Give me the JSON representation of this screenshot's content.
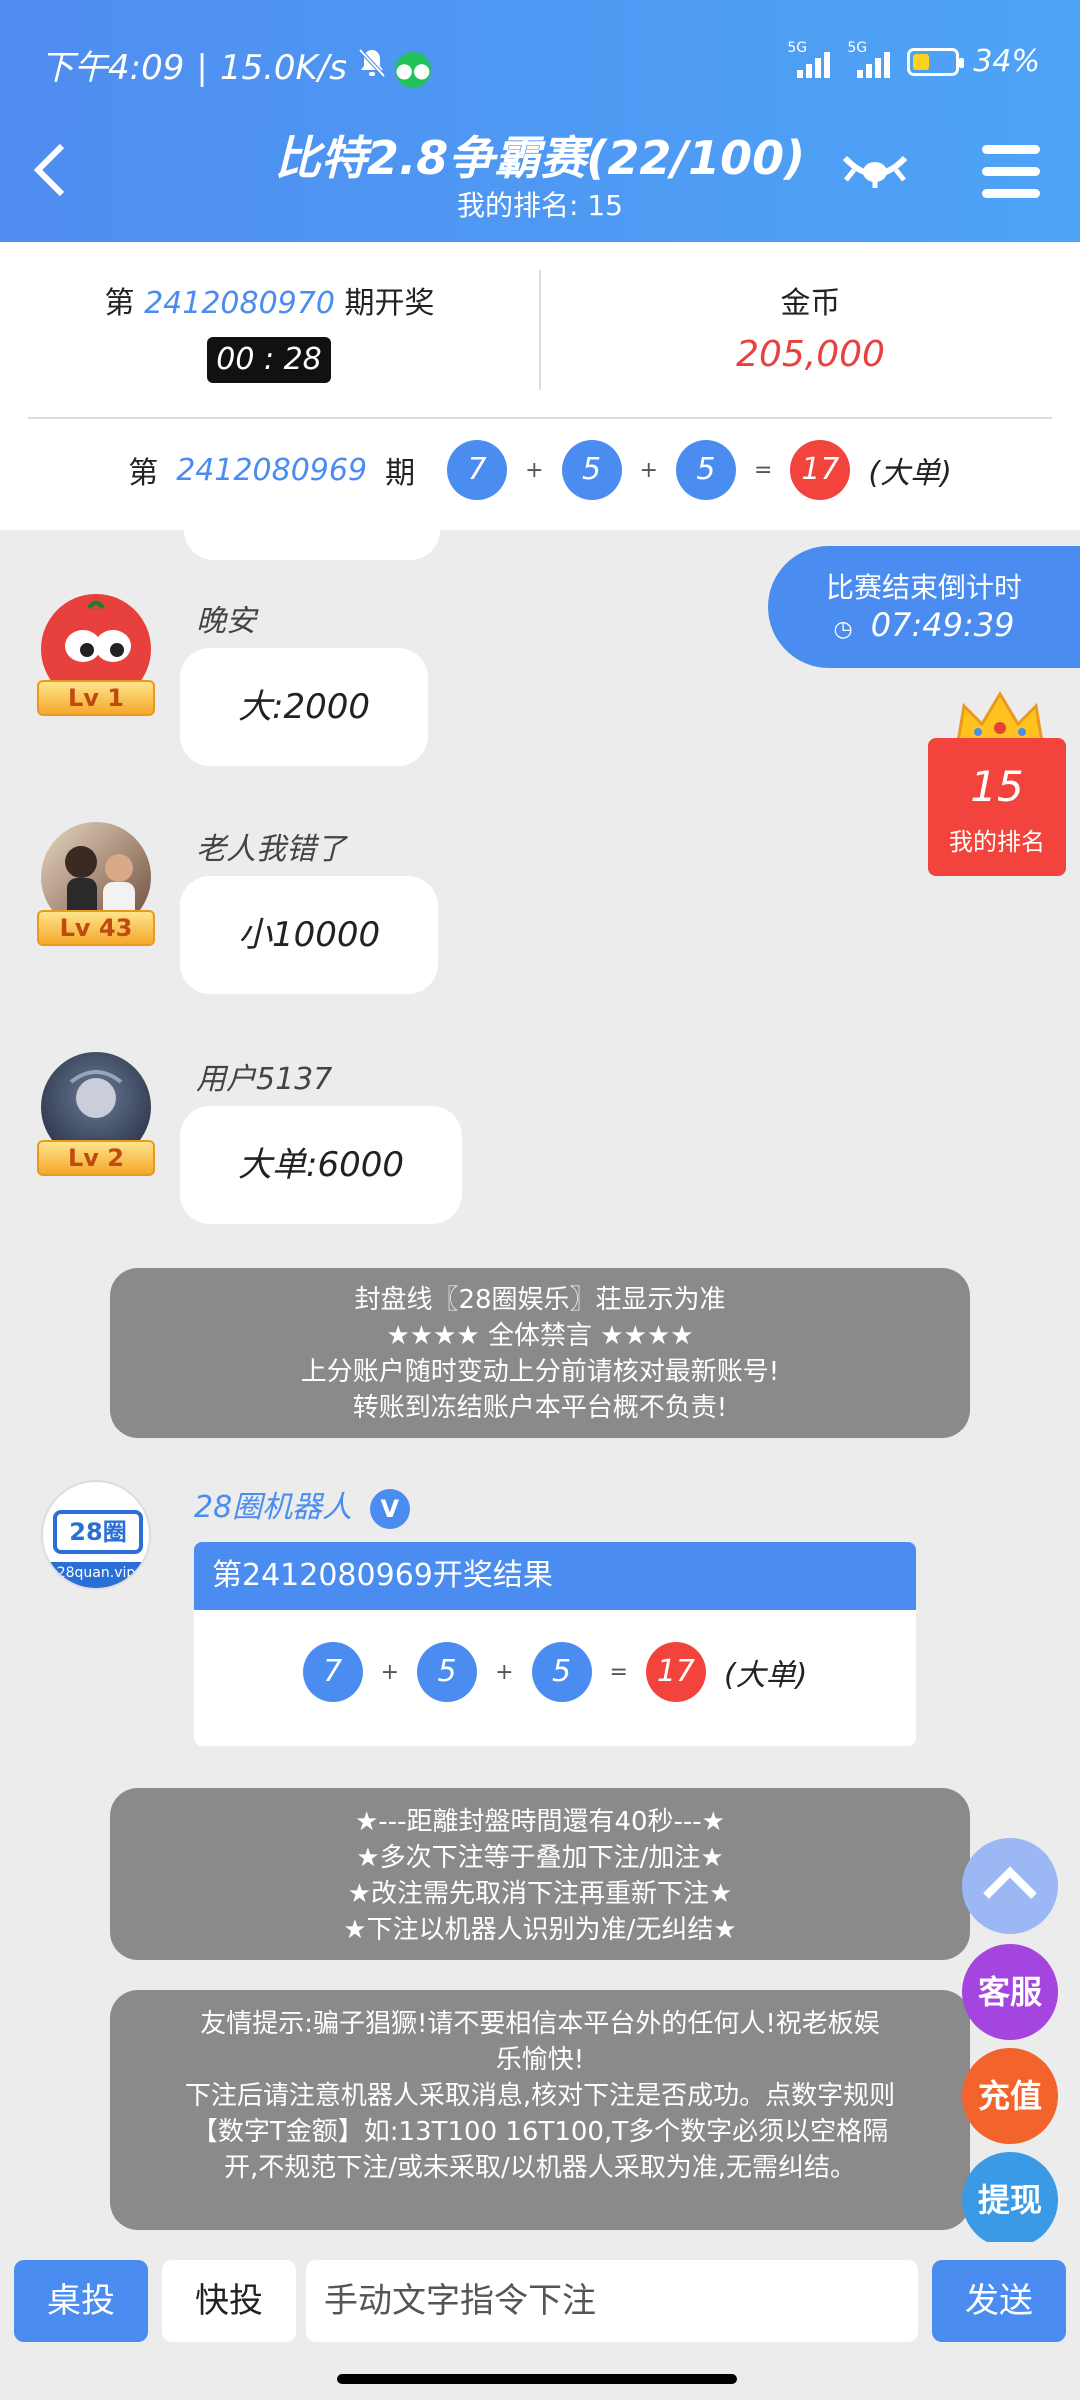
{
  "status_bar": {
    "time": "下午4:09",
    "speed": "15.0K/s",
    "signal1": "5G",
    "signal2": "5G",
    "battery": "34%"
  },
  "header": {
    "title": "比特2.8争霸赛(22/100)",
    "subtitle": "我的排名: 15"
  },
  "draw": {
    "prefix": "第",
    "number": "2412080970",
    "suffix": "期开奖",
    "timer": "00 : 28"
  },
  "coins": {
    "label": "金币",
    "value": "205,000"
  },
  "previous": {
    "prefix": "第",
    "number": "2412080969",
    "suffix": "期",
    "b1": "7",
    "op1": "+",
    "b2": "5",
    "op2": "+",
    "b3": "5",
    "eq": "=",
    "sum": "17",
    "result": "(大单)"
  },
  "countdown": {
    "label": "比赛结束倒计时",
    "time": "07:49:39"
  },
  "rank": {
    "value": "15",
    "label": "我的排名"
  },
  "messages": [
    {
      "name": "晚安",
      "level": "Lv 1",
      "text": "大:2000"
    },
    {
      "name": "老人我错了",
      "level": "Lv 43",
      "text": "小10000"
    },
    {
      "name": "用户5137",
      "level": "Lv 2",
      "text": "大单:6000"
    }
  ],
  "notice1": {
    "line1": "封盘线〖28圈娱乐〗荘显示为准",
    "line2": "★★★★ 全体禁言 ★★★★",
    "line3": "上分账户随时变动上分前请核对最新账号!",
    "line4": "转账到冻结账户本平台概不负责!"
  },
  "robot": {
    "name": "28圈机器人",
    "badge": "V",
    "logo_text": "28圈",
    "logo_url": "28quan.vip",
    "card_title": "第2412080969开奖结果",
    "b1": "7",
    "op1": "+",
    "b2": "5",
    "op2": "+",
    "b3": "5",
    "eq": "=",
    "sum": "17",
    "result": "(大单)"
  },
  "notice2": {
    "line1": "★---距離封盤時間還有40秒---★",
    "line2": "★多次下注等于叠加下注/加注★",
    "line3": "★改注需先取消下注再重新下注★",
    "line4": "★下注以机器人识别为准/无纠结★"
  },
  "notice3": {
    "line1": "友情提示:骗子猖獗!请不要相信本平台外的任何人!祝老板娱",
    "line2": "乐愉快!",
    "line3": "下注后请注意机器人采取消息,核对下注是否成功。点数字规则",
    "line4": "【数字T金额】如:13T100 16T100,T多个数字必须以空格隔",
    "line5": "开,不规范下注/或未采取/以机器人采取为准,无需纠结。"
  },
  "side_buttons": {
    "service": "客服",
    "recharge": "充值",
    "withdraw": "提现"
  },
  "bottom": {
    "table_bet": "桌投",
    "quick_bet": "快投",
    "placeholder": "手动文字指令下注",
    "send": "发送"
  },
  "colors": {
    "accent": "#4a8cf0",
    "danger": "#f2443c",
    "notice_bg": "#8a8a8a"
  }
}
